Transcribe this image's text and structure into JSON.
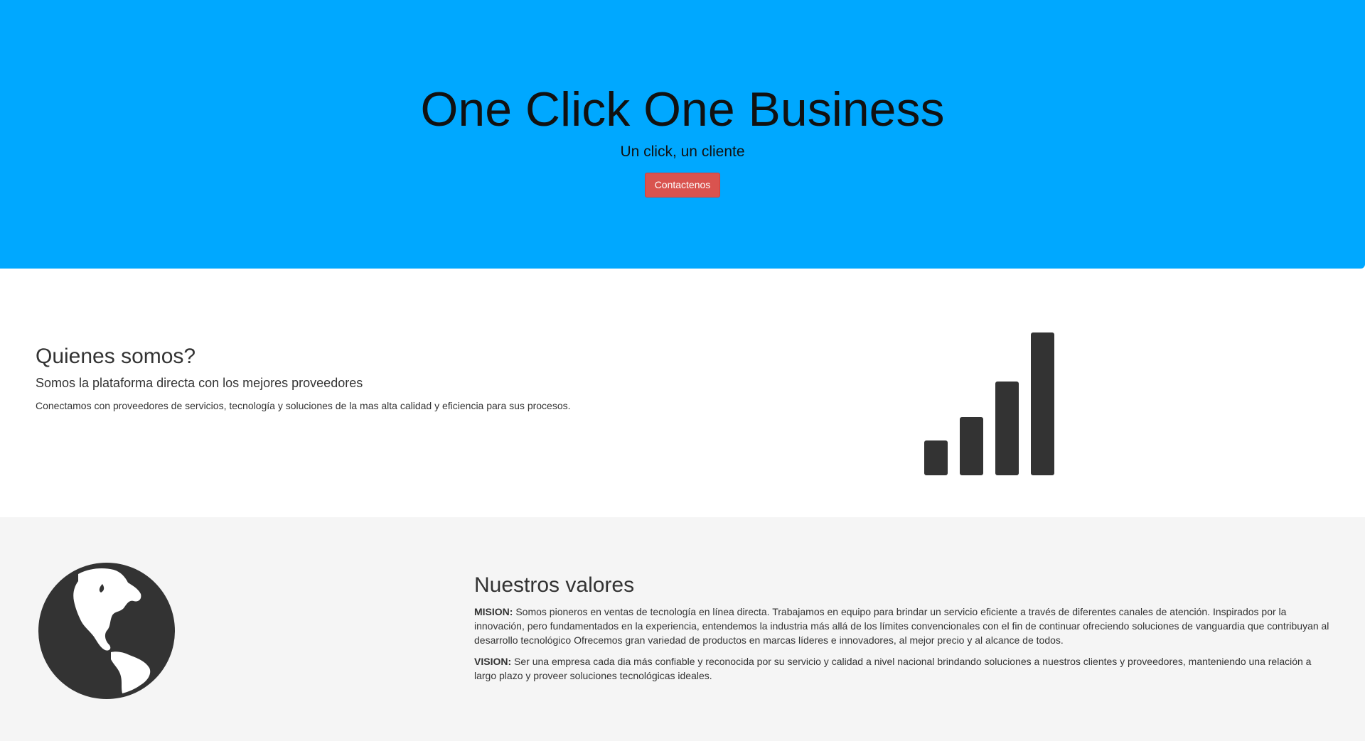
{
  "hero": {
    "title": "One Click One Business",
    "subtitle": "Un click, un cliente",
    "button_label": "Contactenos",
    "background_color": "#00a8ff",
    "button_color": "#d9534f"
  },
  "about": {
    "heading": "Quienes somos?",
    "subheading": "Somos la plataforma directa con los mejores proveedores",
    "text": "Conectamos con proveedores de servicios, tecnología y soluciones de la mas alta calidad y eficiencia para sus procesos.",
    "icon": "signal-bars-icon"
  },
  "values": {
    "heading": "Nuestros valores",
    "icon": "globe-icon",
    "background_color": "#f5f5f5",
    "mision_label": "MISION:",
    "mision_text": " Somos pioneros en ventas de tecnología en línea directa. Trabajamos en equipo para brindar un servicio eficiente a través de diferentes canales de atención. Inspirados por la innovación, pero fundamentados en la experiencia, entendemos la industria más allá de los límites convencionales con el fin de continuar ofreciendo soluciones de vanguardia que contribuyan al desarrollo tecnológico Ofrecemos gran variedad de productos en marcas líderes e innovadores, al mejor precio y al alcance de todos.",
    "vision_label": "VISION:",
    "vision_text": " Ser una empresa cada dia más confiable y reconocida por su servicio y calidad a nivel nacional brindando soluciones a nuestros clientes y proveedores, manteniendo una relación a largo plazo y proveer soluciones tecnológicas ideales."
  }
}
